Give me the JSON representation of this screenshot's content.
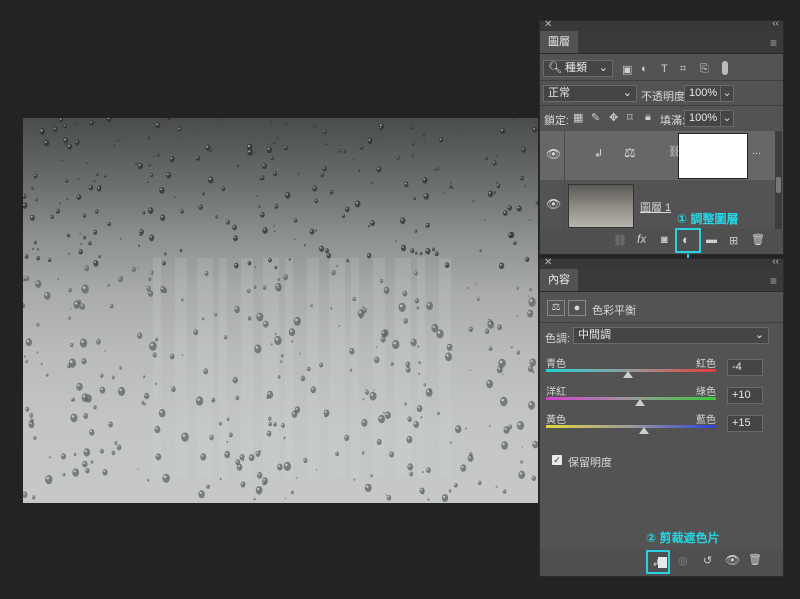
{
  "layers_panel": {
    "title": "圖層",
    "filter_kind": "種類",
    "blend_mode": "正常",
    "opacity_label": "不透明度:",
    "opacity_value": "100%",
    "lock_label": "鎖定:",
    "fill_label": "填滿:",
    "fill_value": "100%",
    "layer2_name": "圖層 1",
    "ellipsis": "...",
    "annotation_adjust": "① 調整圖層"
  },
  "properties_panel": {
    "title": "內容",
    "adjustment_name": "色彩平衡",
    "tone_label": "色調:",
    "tone_value": "中間調",
    "sliders": [
      {
        "left": "青色",
        "right": "紅色",
        "value": "-4",
        "position": 0.48,
        "gradient": [
          "#25d0d8",
          "#e23a3a"
        ]
      },
      {
        "left": "洋紅",
        "right": "綠色",
        "value": "+10",
        "position": 0.55,
        "gradient": [
          "#d040d0",
          "#38c838"
        ]
      },
      {
        "left": "黃色",
        "right": "藍色",
        "value": "+15",
        "position": 0.575,
        "gradient": [
          "#e4d840",
          "#3040d8"
        ]
      }
    ],
    "preserve_luminosity": "保留明度",
    "preserve_checked": true,
    "annotation_clip": "② 剪裁遮色片"
  },
  "colors": {
    "accent": "#27d3e1",
    "panel": "#535353",
    "background": "#232323"
  }
}
